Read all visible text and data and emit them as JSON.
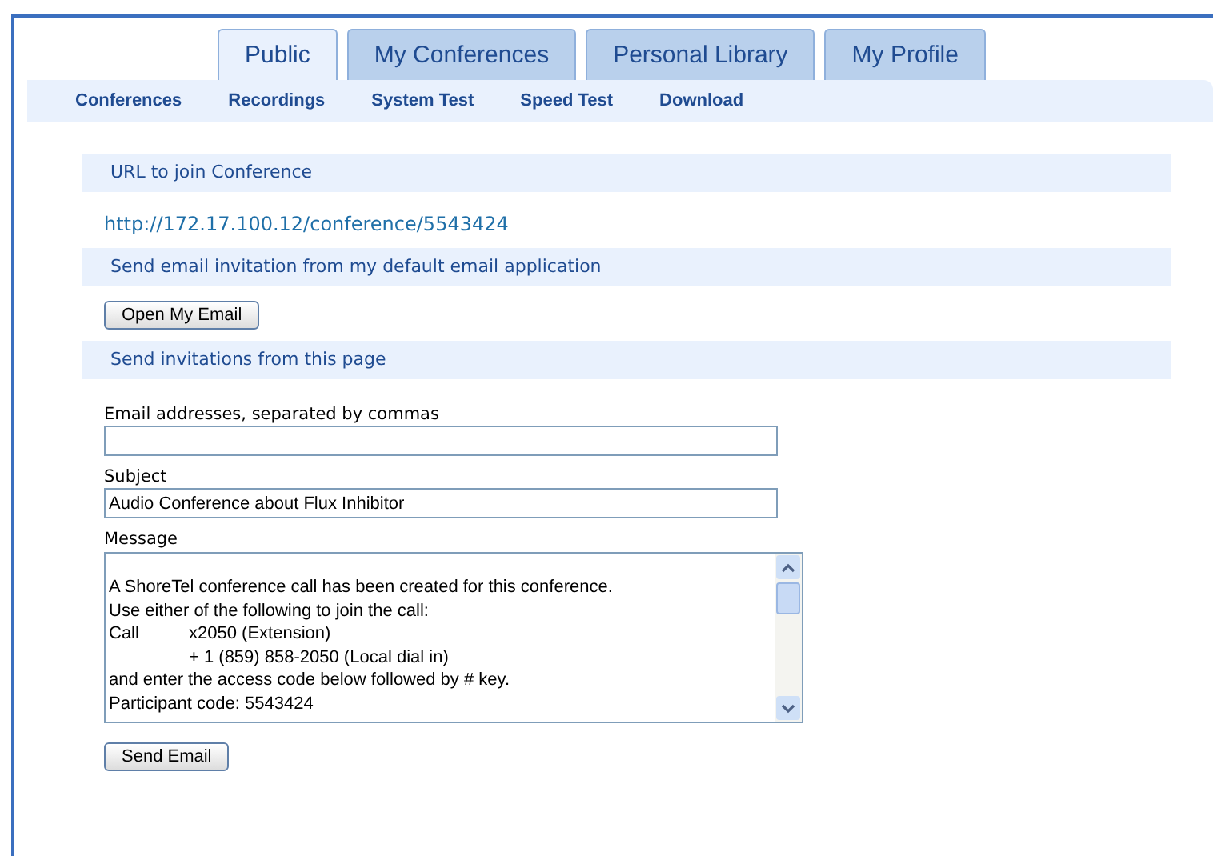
{
  "tabs": [
    {
      "label": "Public",
      "selected": true
    },
    {
      "label": "My Conferences",
      "selected": false
    },
    {
      "label": "Personal Library",
      "selected": false
    },
    {
      "label": "My Profile",
      "selected": false
    }
  ],
  "subnav": [
    "Conferences",
    "Recordings",
    "System Test",
    "Speed Test",
    "Download"
  ],
  "sections": [
    {
      "kind": "link",
      "heading": "URL to join Conference",
      "link": "http://172.17.100.12/conference/5543424"
    },
    {
      "kind": "button",
      "heading": "Send email invitation from my default email application",
      "button": "Open My Email"
    },
    {
      "kind": "form",
      "heading": "Send invitations from this page",
      "fields": [
        {
          "label": "Email addresses, separated by commas"
        },
        {
          "label": "Subject",
          "value": "Audio Conference about Flux Inhibitor"
        }
      ],
      "message": {
        "label": "Message",
        "lines": [
          "A ShoreTel conference call has been created for this conference.",
          "Use either of the following to join the call:",
          "Call\tx2050 (Extension)",
          "\t+ 1 (859) 858-2050 (Local dial in)",
          "and enter the access code below followed by # key.",
          "Participant code: 5543424"
        ]
      },
      "button": "Send Email"
    }
  ]
}
